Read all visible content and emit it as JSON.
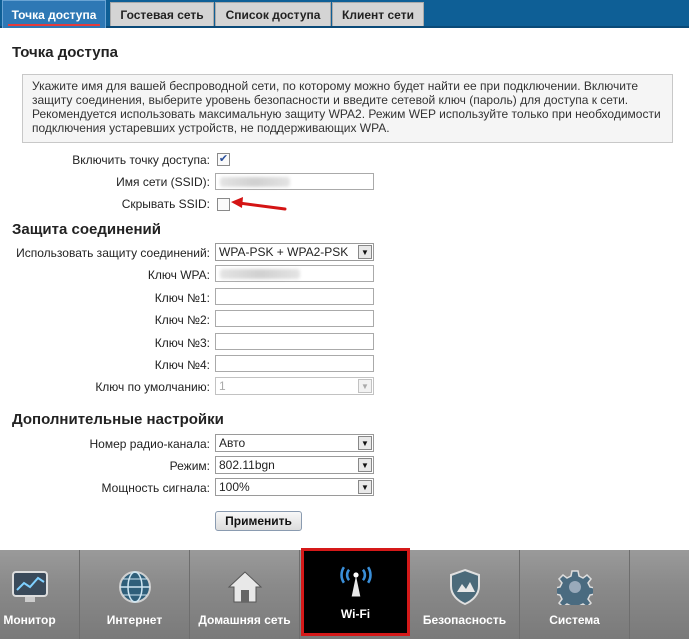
{
  "tabs": [
    {
      "label": "Точка доступа",
      "active": true
    },
    {
      "label": "Гостевая сеть"
    },
    {
      "label": "Список доступа"
    },
    {
      "label": "Клиент сети"
    }
  ],
  "section_ap": {
    "title": "Точка доступа",
    "info": "Укажите имя для вашей беспроводной сети, по которому можно будет найти ее при подключении. Включите защиту соединения, выберите уровень безопасности и введите сетевой ключ (пароль) для доступа к сети. Рекомендуется использовать максимальную защиту WPA2. Режим WEP используйте только при необходимости подключения устаревших устройств, не поддерживающих WPA.",
    "enable_label": "Включить точку доступа:",
    "enable_checked": true,
    "ssid_label": "Имя сети (SSID):",
    "hide_label": "Скрывать SSID:",
    "hide_checked": false
  },
  "section_security": {
    "title": "Защита соединений",
    "mode_label": "Использовать защиту соединений:",
    "mode_value": "WPA-PSK + WPA2-PSK",
    "wpa_key_label": "Ключ WPA:",
    "key1_label": "Ключ №1:",
    "key2_label": "Ключ №2:",
    "key3_label": "Ключ №3:",
    "key4_label": "Ключ №4:",
    "default_key_label": "Ключ по умолчанию:",
    "default_key_value": "1"
  },
  "section_advanced": {
    "title": "Дополнительные настройки",
    "channel_label": "Номер радио-канала:",
    "channel_value": "Авто",
    "mode_label": "Режим:",
    "mode_value": "802.11bgn",
    "power_label": "Мощность сигнала:",
    "power_value": "100%"
  },
  "apply_label": "Применить",
  "bottom_nav": [
    {
      "label": "Монитор",
      "icon": "monitor-icon"
    },
    {
      "label": "Интернет",
      "icon": "globe-icon"
    },
    {
      "label": "Домашняя сеть",
      "icon": "home-icon"
    },
    {
      "label": "Wi-Fi",
      "icon": "wifi-icon",
      "active": true
    },
    {
      "label": "Безопасность",
      "icon": "shield-icon"
    },
    {
      "label": "Система",
      "icon": "gear-icon"
    }
  ],
  "colors": {
    "tabbar": "#0e5f96",
    "highlight": "#d51919"
  }
}
